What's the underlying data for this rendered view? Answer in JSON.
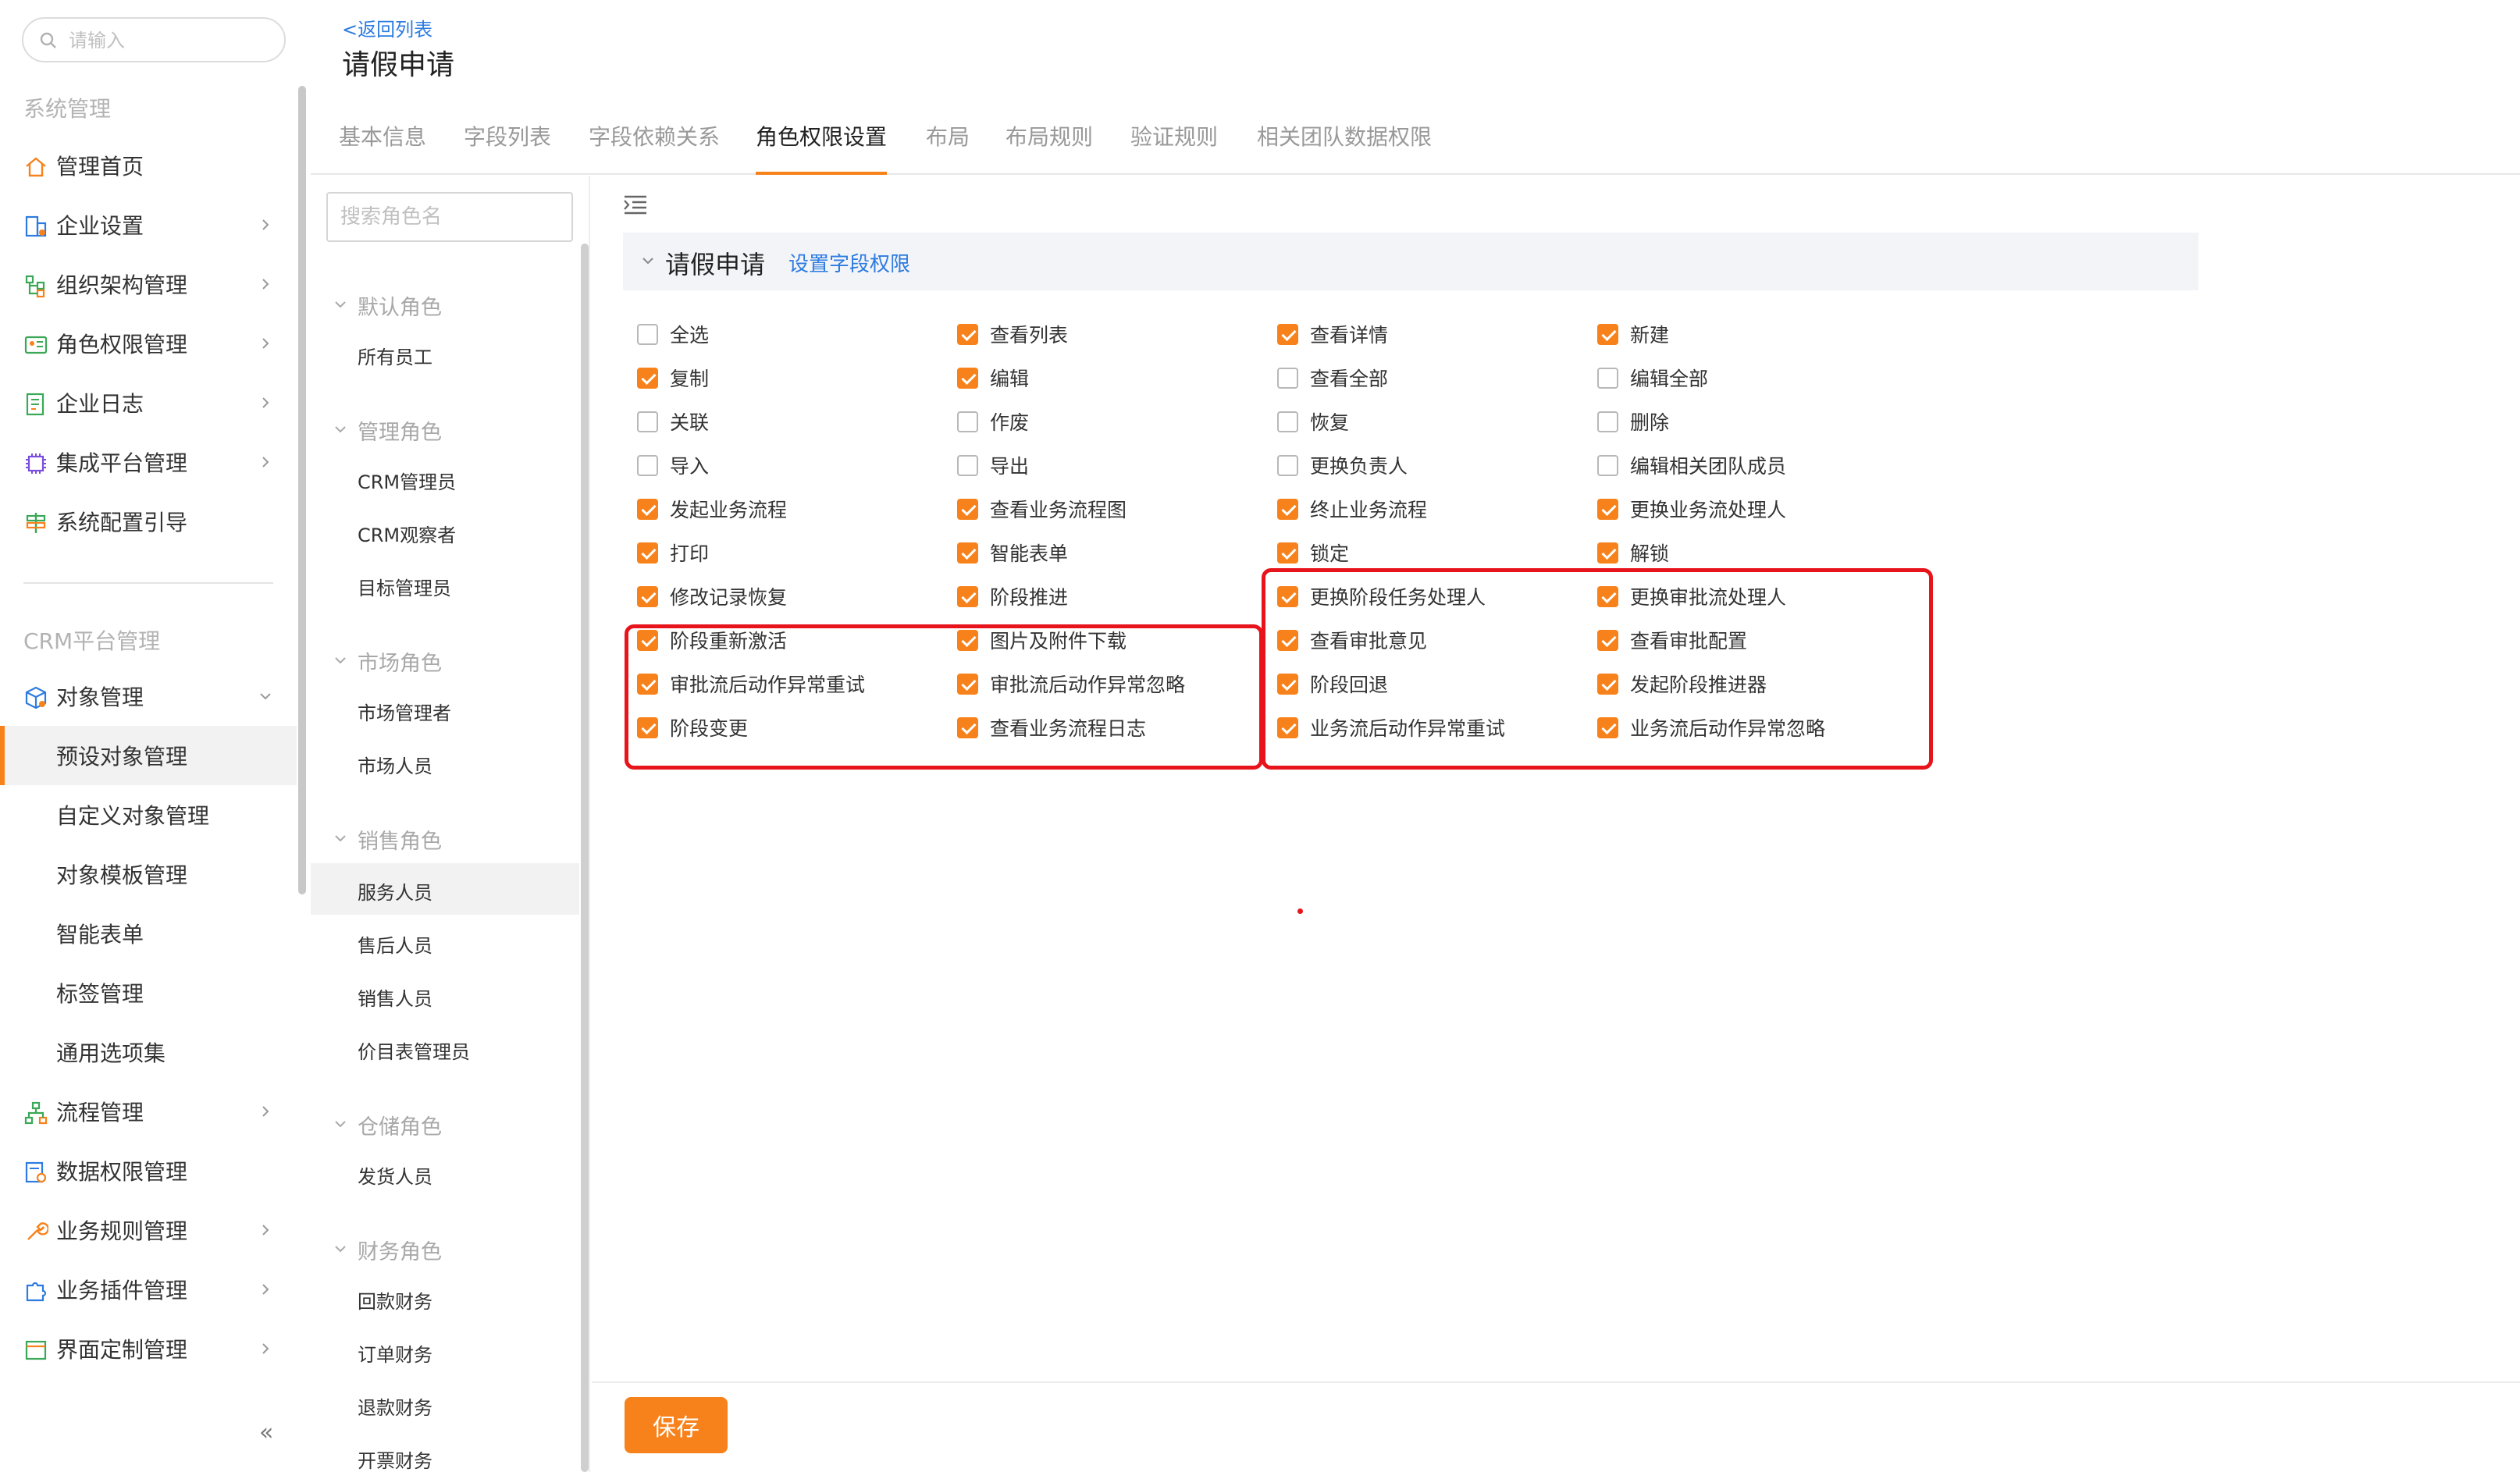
{
  "sidebar": {
    "search_placeholder": "请输入",
    "section1": "系统管理",
    "items1": [
      {
        "label": "管理首页",
        "icon": "home-icon"
      },
      {
        "label": "企业设置",
        "icon": "building-icon"
      },
      {
        "label": "组织架构管理",
        "icon": "org-tree-icon"
      },
      {
        "label": "角色权限管理",
        "icon": "id-card-icon"
      },
      {
        "label": "企业日志",
        "icon": "log-icon"
      },
      {
        "label": "集成平台管理",
        "icon": "chip-icon"
      },
      {
        "label": "系统配置引导",
        "icon": "signpost-icon"
      }
    ],
    "section2": "CRM平台管理",
    "object_mgmt": "对象管理",
    "sub_items": [
      "预设对象管理",
      "自定义对象管理",
      "对象模板管理",
      "智能表单",
      "标签管理",
      "通用选项集"
    ],
    "items2": [
      {
        "label": "流程管理",
        "icon": "flow-icon"
      },
      {
        "label": "数据权限管理",
        "icon": "data-permission-icon"
      },
      {
        "label": "业务规则管理",
        "icon": "wrench-icon"
      },
      {
        "label": "业务插件管理",
        "icon": "puzzle-icon"
      },
      {
        "label": "界面定制管理",
        "icon": "layout-icon"
      }
    ],
    "collapse": "«"
  },
  "header": {
    "back": "<返回列表",
    "title": "请假申请",
    "tabs": [
      "基本信息",
      "字段列表",
      "字段依赖关系",
      "角色权限设置",
      "布局",
      "布局规则",
      "验证规则",
      "相关团队数据权限"
    ]
  },
  "roles": {
    "search_placeholder": "搜索角色名",
    "groups": [
      {
        "name": "默认角色",
        "roles": [
          "所有员工"
        ]
      },
      {
        "name": "管理角色",
        "roles": [
          "CRM管理员",
          "CRM观察者",
          "目标管理员"
        ]
      },
      {
        "name": "市场角色",
        "roles": [
          "市场管理者",
          "市场人员"
        ]
      },
      {
        "name": "销售角色",
        "roles": [
          "服务人员",
          "售后人员",
          "销售人员",
          "价目表管理员"
        ]
      },
      {
        "name": "仓储角色",
        "roles": [
          "发货人员"
        ]
      },
      {
        "name": "财务角色",
        "roles": [
          "回款财务",
          "订单财务",
          "退款财务",
          "开票财务"
        ]
      }
    ],
    "selected": "服务人员"
  },
  "permissions": {
    "section_title": "请假申请",
    "field_link": "设置字段权限",
    "rows": [
      [
        {
          "label": "全选",
          "checked": false
        },
        {
          "label": "查看列表",
          "checked": true
        },
        {
          "label": "查看详情",
          "checked": true
        },
        {
          "label": "新建",
          "checked": true
        }
      ],
      [
        {
          "label": "复制",
          "checked": true
        },
        {
          "label": "编辑",
          "checked": true
        },
        {
          "label": "查看全部",
          "checked": false
        },
        {
          "label": "编辑全部",
          "checked": false
        }
      ],
      [
        {
          "label": "关联",
          "checked": false
        },
        {
          "label": "作废",
          "checked": false
        },
        {
          "label": "恢复",
          "checked": false
        },
        {
          "label": "删除",
          "checked": false
        }
      ],
      [
        {
          "label": "导入",
          "checked": false
        },
        {
          "label": "导出",
          "checked": false
        },
        {
          "label": "更换负责人",
          "checked": false
        },
        {
          "label": "编辑相关团队成员",
          "checked": false
        }
      ],
      [
        {
          "label": "发起业务流程",
          "checked": true
        },
        {
          "label": "查看业务流程图",
          "checked": true
        },
        {
          "label": "终止业务流程",
          "checked": true
        },
        {
          "label": "更换业务流处理人",
          "checked": true
        }
      ],
      [
        {
          "label": "打印",
          "checked": true
        },
        {
          "label": "智能表单",
          "checked": true
        },
        {
          "label": "锁定",
          "checked": true
        },
        {
          "label": "解锁",
          "checked": true
        }
      ],
      [
        {
          "label": "修改记录恢复",
          "checked": true
        },
        {
          "label": "阶段推进",
          "checked": true
        },
        {
          "label": "更换阶段任务处理人",
          "checked": true
        },
        {
          "label": "更换审批流处理人",
          "checked": true
        }
      ],
      [
        {
          "label": "阶段重新激活",
          "checked": true
        },
        {
          "label": "图片及附件下载",
          "checked": true
        },
        {
          "label": "查看审批意见",
          "checked": true
        },
        {
          "label": "查看审批配置",
          "checked": true
        }
      ],
      [
        {
          "label": "审批流后动作异常重试",
          "checked": true
        },
        {
          "label": "审批流后动作异常忽略",
          "checked": true
        },
        {
          "label": "阶段回退",
          "checked": true
        },
        {
          "label": "发起阶段推进器",
          "checked": true
        }
      ],
      [
        {
          "label": "阶段变更",
          "checked": true
        },
        {
          "label": "查看业务流程日志",
          "checked": true
        },
        {
          "label": "业务流后动作异常重试",
          "checked": true
        },
        {
          "label": "业务流后动作异常忽略",
          "checked": true
        }
      ]
    ]
  },
  "save_button": "保存",
  "colors": {
    "accent": "#f7821b",
    "link": "#2d7be0",
    "highlight": "#e8141b"
  }
}
